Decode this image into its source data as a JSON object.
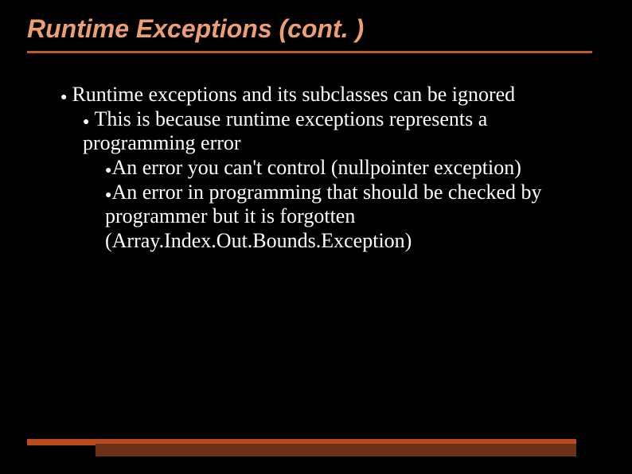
{
  "title": "Runtime Exceptions (cont. )",
  "bullets": {
    "b1": "Runtime exceptions and its subclasses can be ignored",
    "b2": "This is because runtime exceptions represents a programming error",
    "b3": "An error you can't control (nullpointer exception)",
    "b4": "An error in programming that should be checked by programmer but it is forgotten (Array.Index.Out.Bounds.Exception)"
  }
}
